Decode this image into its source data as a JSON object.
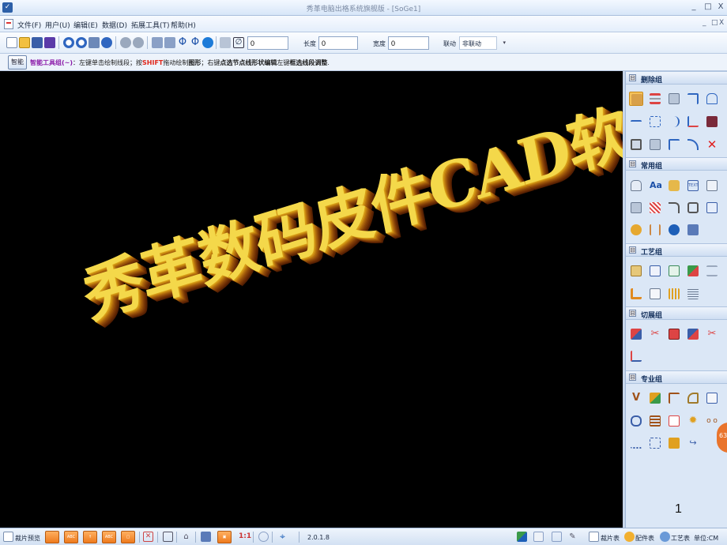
{
  "window": {
    "title": "秀革电脑出格系统旗舰版 - [SoGe1]",
    "min": "_",
    "restore": "□",
    "close": "X"
  },
  "menubar": {
    "items": [
      "文件(F)",
      "用户(U)",
      "编辑(E)",
      "数据(D)",
      "拓展工具(T)",
      "帮助(H)"
    ],
    "mdi": {
      "min": "_",
      "restore": "□",
      "close": "X"
    }
  },
  "toolbar": {
    "input_value": "0",
    "length_label": "长度",
    "length_value": "0",
    "width_label": "宽度",
    "width_value": "0",
    "link_label": "联动",
    "link_value": "非联动",
    "link_arrow": "▾",
    "icons": [
      "new-icon",
      "open-icon",
      "save-icon",
      "save-all-icon",
      "zoom-in-icon",
      "zoom-out-icon",
      "fit-icon",
      "pan-icon",
      "undo-icon",
      "redo-icon",
      "pencil-icon",
      "pencil-alt-icon",
      "phi-icon",
      "phi-alt-icon",
      "refresh-icon",
      "ruler-icon",
      "diameter-icon"
    ]
  },
  "smartbar": {
    "icon_text": "智能",
    "group": "智能工具组(~)",
    "t1": "：左键单击绘制线段；按",
    "shift": "SHIFT",
    "t2": "拖动绘制",
    "t3": "图形",
    "t4": "；右键",
    "t5": "点选节点线形状编辑",
    "t6": "左键",
    "t7": "框选线段调整",
    "t8": "."
  },
  "canvas": {
    "art_text": "秀革数码皮件CAD软件"
  },
  "panel": {
    "groups": [
      {
        "label": "删除组",
        "toggle": "⊟"
      },
      {
        "label": "常用组",
        "toggle": "⊟"
      },
      {
        "label": "工艺组",
        "toggle": "⊟"
      },
      {
        "label": "切展组",
        "toggle": "⊟"
      },
      {
        "label": "专业组",
        "toggle": "⊟"
      }
    ]
  },
  "slide_number": "1",
  "float_badge": "63",
  "statusbar": {
    "preview": "裁片预览",
    "version": "2.0.1.8",
    "cut_table": "裁片表",
    "parts_table": "配件表",
    "process_table": "工艺表",
    "unit": "单位:CM"
  },
  "colors": {
    "canvas_bg": "#000000",
    "art_face": "#f4d84a",
    "art_extrude": "#884408",
    "accent_orange": "#ee7a1e"
  }
}
